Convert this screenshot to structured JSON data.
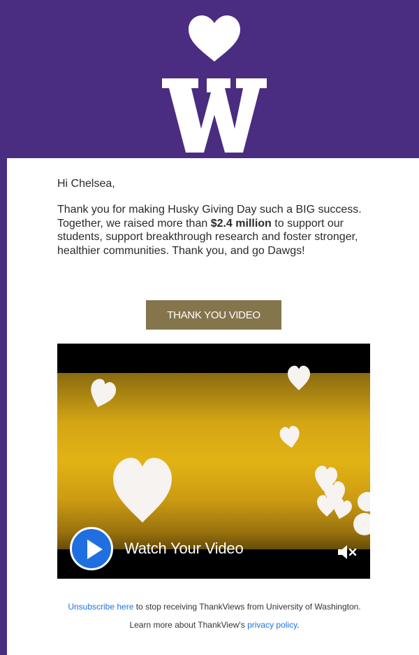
{
  "greeting": "Hi Chelsea,",
  "message": {
    "part1": "Thank you for making Husky Giving Day such a BIG success. Together, we raised more than ",
    "amount": "$2.4 million",
    "part2": " to support our students, support breakthrough research and foster stronger, healthier communities. Thank you, and go Dawgs!"
  },
  "cta_label": "THANK YOU VIDEO",
  "video": {
    "watch_label": "Watch Your Video"
  },
  "footer": {
    "unsubscribe_link": "Unsubscribe here",
    "line1_rest": " to stop receiving ThankViews from University of Washington. Learn more about ThankView's ",
    "privacy_link": "privacy policy",
    "period": "."
  },
  "colors": {
    "brand_purple": "#4a2c80",
    "button_gold": "#85754d",
    "video_gold": "#e2b315",
    "play_blue": "#1f6fe0",
    "link_blue": "#1a73e8"
  },
  "icons": [
    "heart-icon",
    "university-w-logo",
    "play-icon",
    "mute-icon"
  ]
}
